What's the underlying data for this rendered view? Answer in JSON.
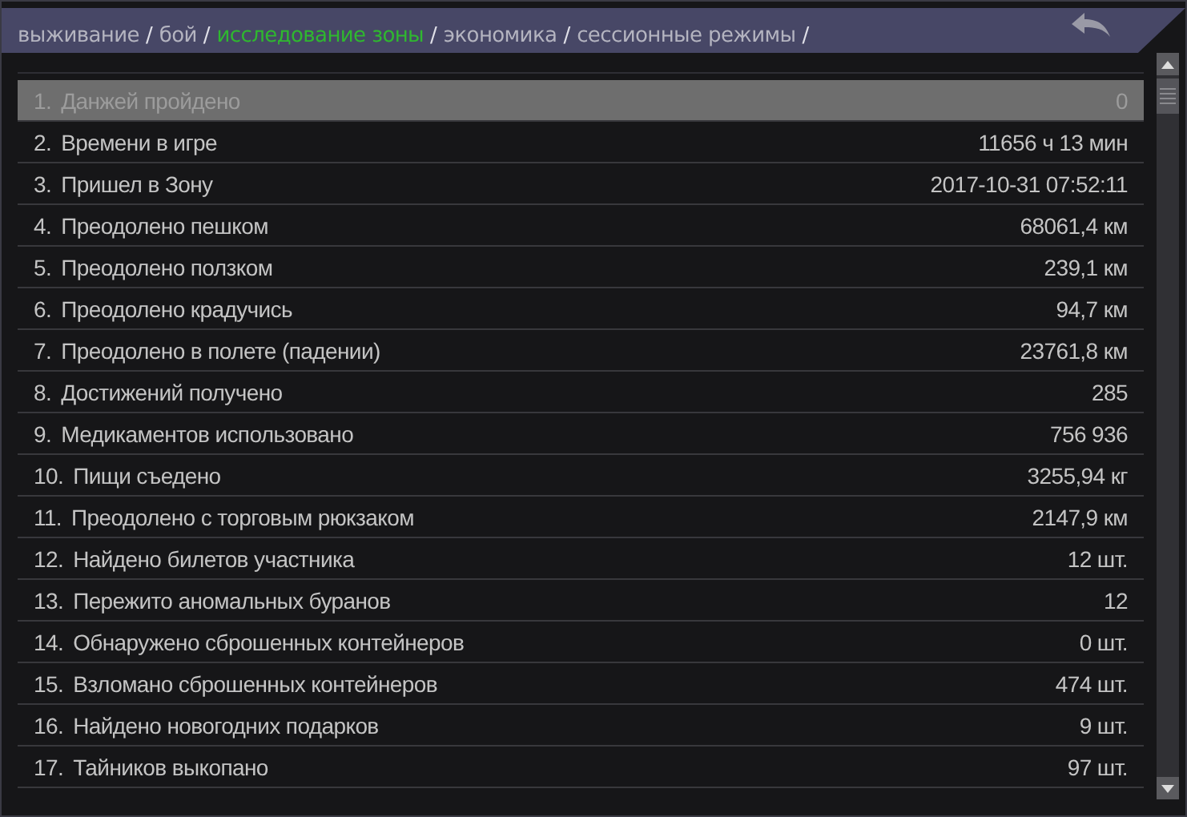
{
  "breadcrumb": [
    {
      "label": "выживание",
      "selected": false
    },
    {
      "label": "бой",
      "selected": false
    },
    {
      "label": "исследование зоны",
      "selected": true
    },
    {
      "label": "экономика",
      "selected": false
    },
    {
      "label": "сессионные режимы",
      "selected": false
    }
  ],
  "separator": "/",
  "stats": [
    {
      "index": "1.",
      "name": "Данжей пройдено",
      "value": "0",
      "selected": true
    },
    {
      "index": "2.",
      "name": "Времени в игре",
      "value": "11656 ч 13 мин",
      "selected": false
    },
    {
      "index": "3.",
      "name": "Пришел в Зону",
      "value": "2017-10-31 07:52:11",
      "selected": false
    },
    {
      "index": "4.",
      "name": "Преодолено пешком",
      "value": "68061,4 км",
      "selected": false
    },
    {
      "index": "5.",
      "name": "Преодолено ползком",
      "value": "239,1 км",
      "selected": false
    },
    {
      "index": "6.",
      "name": "Преодолено крадучись",
      "value": "94,7 км",
      "selected": false
    },
    {
      "index": "7.",
      "name": "Преодолено в полете (падении)",
      "value": "23761,8 км",
      "selected": false
    },
    {
      "index": "8.",
      "name": "Достижений получено",
      "value": "285",
      "selected": false
    },
    {
      "index": "9.",
      "name": "Медикаментов использовано",
      "value": "756 936",
      "selected": false
    },
    {
      "index": "10.",
      "name": "Пищи съедено",
      "value": "3255,94 кг",
      "selected": false
    },
    {
      "index": "11.",
      "name": "Преодолено с торговым рюкзаком",
      "value": "2147,9 км",
      "selected": false
    },
    {
      "index": "12.",
      "name": "Найдено билетов участника",
      "value": "12 шт.",
      "selected": false
    },
    {
      "index": "13.",
      "name": "Пережито аномальных буранов",
      "value": "12",
      "selected": false
    },
    {
      "index": "14.",
      "name": "Обнаружено сброшенных контейнеров",
      "value": "0 шт.",
      "selected": false
    },
    {
      "index": "15.",
      "name": "Взломано сброшенных контейнеров",
      "value": "474 шт.",
      "selected": false
    },
    {
      "index": "16.",
      "name": "Найдено новогодних подарков",
      "value": "9 шт.",
      "selected": false
    },
    {
      "index": "17.",
      "name": "Тайников выкопано",
      "value": "97 шт.",
      "selected": false
    }
  ]
}
